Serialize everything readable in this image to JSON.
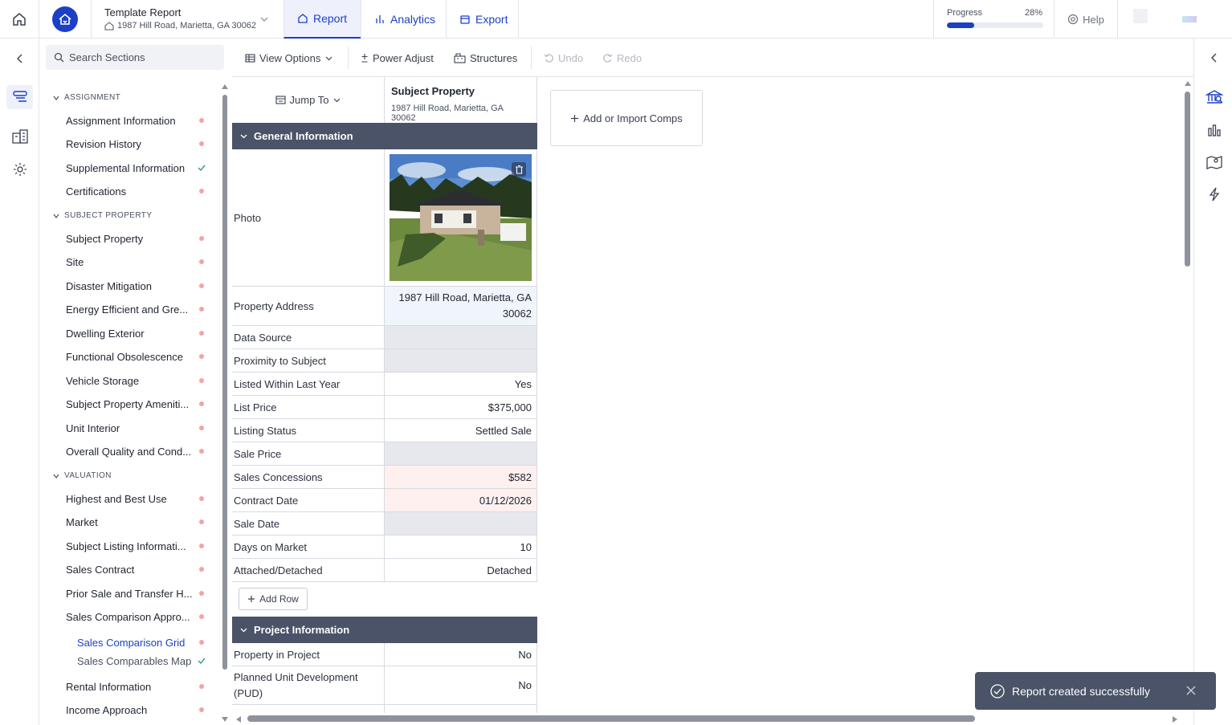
{
  "header": {
    "report_title": "Template Report",
    "report_address": "1987 Hill Road, Marietta, GA 30062",
    "tabs": [
      {
        "label": "Report",
        "active": true
      },
      {
        "label": "Analytics",
        "active": false
      },
      {
        "label": "Export",
        "active": false
      }
    ],
    "progress_label": "Progress",
    "progress_value": "28%",
    "progress_fraction": 0.28,
    "help_label": "Help"
  },
  "sidebar": {
    "search_placeholder": "Search Sections",
    "sections": [
      {
        "title": "ASSIGNMENT",
        "items": [
          {
            "label": "Assignment Information",
            "status": "dot"
          },
          {
            "label": "Revision History",
            "status": "dot"
          },
          {
            "label": "Supplemental Information",
            "status": "check"
          },
          {
            "label": "Certifications",
            "status": "dot"
          }
        ]
      },
      {
        "title": "SUBJECT PROPERTY",
        "items": [
          {
            "label": "Subject Property",
            "status": "dot"
          },
          {
            "label": "Site",
            "status": "dot"
          },
          {
            "label": "Disaster Mitigation",
            "status": "dot"
          },
          {
            "label": "Energy Efficient and Gre...",
            "status": "dot"
          },
          {
            "label": "Dwelling Exterior",
            "status": "dot"
          },
          {
            "label": "Functional Obsolescence",
            "status": "dot"
          },
          {
            "label": "Vehicle Storage",
            "status": "dot"
          },
          {
            "label": "Subject Property Ameniti...",
            "status": "dot"
          },
          {
            "label": "Unit Interior",
            "status": "dot"
          },
          {
            "label": "Overall Quality and Cond...",
            "status": "dot"
          }
        ]
      },
      {
        "title": "VALUATION",
        "items": [
          {
            "label": "Highest and Best Use",
            "status": "dot"
          },
          {
            "label": "Market",
            "status": "dot"
          },
          {
            "label": "Subject Listing Informati...",
            "status": "dot"
          },
          {
            "label": "Sales Contract",
            "status": "dot"
          },
          {
            "label": "Prior Sale and Transfer H...",
            "status": "dot"
          },
          {
            "label": "Sales Comparison Appro...",
            "status": "dot"
          },
          {
            "label": "Sales Comparison Grid",
            "status": "dot",
            "sub": true,
            "current": true
          },
          {
            "label": "Sales Comparables Map",
            "status": "check",
            "sub": true
          },
          {
            "label": "Rental Information",
            "status": "dot"
          },
          {
            "label": "Income Approach",
            "status": "dot"
          }
        ]
      }
    ]
  },
  "toolbar": {
    "view_options": "View Options",
    "power_adjust": "Power Adjust",
    "structures": "Structures",
    "undo": "Undo",
    "redo": "Redo"
  },
  "grid": {
    "jump_to": "Jump To",
    "subject_title": "Subject Property",
    "subject_address": "1987 Hill Road, Marietta, GA 30062",
    "general_section": "General Information",
    "photo_label": "Photo",
    "rows": [
      {
        "label": "Property Address",
        "value": "1987 Hill Road, Marietta, GA 30062",
        "style": "blue"
      },
      {
        "label": "Data Source",
        "value": "",
        "style": "grey"
      },
      {
        "label": "Proximity to Subject",
        "value": "",
        "style": "grey"
      },
      {
        "label": "Listed Within Last Year",
        "value": "Yes",
        "style": ""
      },
      {
        "label": "List Price",
        "value": "$375,000",
        "style": ""
      },
      {
        "label": "Listing Status",
        "value": "Settled Sale",
        "style": ""
      },
      {
        "label": "Sale Price",
        "value": "",
        "style": "grey"
      },
      {
        "label": "Sales Concessions",
        "value": "$582",
        "style": "pink"
      },
      {
        "label": "Contract Date",
        "value": "01/12/2026",
        "style": "pink"
      },
      {
        "label": "Sale Date",
        "value": "",
        "style": "grey"
      },
      {
        "label": "Days on Market",
        "value": "10",
        "style": ""
      },
      {
        "label": "Attached/Detached",
        "value": "Detached",
        "style": ""
      }
    ],
    "add_row": "Add Row",
    "project_section": "Project Information",
    "project_rows": [
      {
        "label": "Property in Project",
        "value": "No"
      },
      {
        "label": "Planned Unit Development (PUD)",
        "value": "No"
      }
    ]
  },
  "comps": {
    "add_label": "Add or Import Comps"
  },
  "toast": {
    "message": "Report created successfully"
  },
  "colors": {
    "accent": "#1b3fc6",
    "section_bar": "#4a5367",
    "status_dot": "#f5a3a3",
    "check": "#2e9e6a"
  }
}
